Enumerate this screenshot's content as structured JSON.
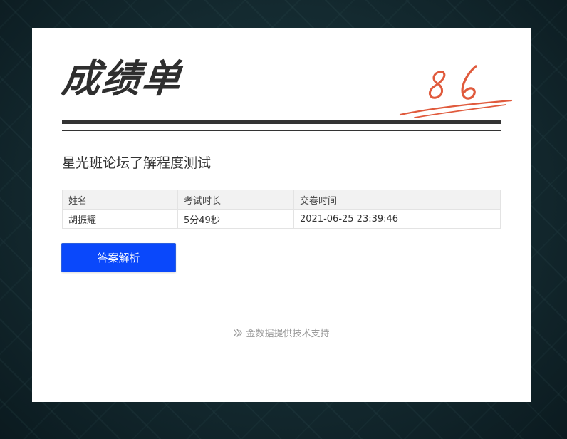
{
  "report": {
    "title": "成绩单",
    "score": "86",
    "exam_name": "星光班论坛了解程度测试"
  },
  "table": {
    "headers": [
      "姓名",
      "考试时长",
      "交卷时间"
    ],
    "row": [
      "胡振耀",
      "5分49秒",
      "2021-06-25 23:39:46"
    ]
  },
  "actions": {
    "answer_analysis_label": "答案解析"
  },
  "footer": {
    "credit_text": "金数据提供技术支持"
  },
  "colors": {
    "accent": "#0a48fb",
    "score_red": "#e05a3c",
    "title_dark": "#2f2f2f"
  }
}
